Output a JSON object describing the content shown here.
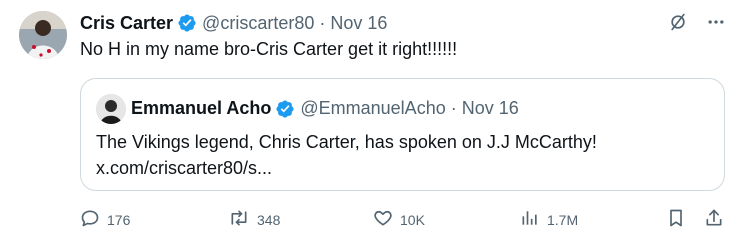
{
  "tweet": {
    "author_name": "Cris Carter",
    "handle": "@criscarter80",
    "separator": "·",
    "date": "Nov 16",
    "text": "No H in my name bro-Cris Carter get it right!!!!!!"
  },
  "quoted": {
    "author_name": "Emmanuel Acho",
    "handle": "@EmmanuelAcho",
    "separator": "·",
    "date": "Nov 16",
    "text_line1": "The Vikings legend, Chris Carter, has spoken on J.J McCarthy!",
    "text_line2": "x.com/criscarter80/s..."
  },
  "actions": {
    "replies": "176",
    "reposts": "348",
    "likes": "10K",
    "views": "1.7M"
  },
  "icons": {
    "verified": "verified-badge-icon",
    "grok": "grok-icon",
    "more": "more-icon",
    "reply": "reply-icon",
    "repost": "repost-icon",
    "like": "heart-icon",
    "views": "views-icon",
    "bookmark": "bookmark-icon",
    "share": "share-icon"
  },
  "colors": {
    "verified": "#1d9bf0",
    "secondary_text": "#536471",
    "border": "#cfd9de"
  }
}
